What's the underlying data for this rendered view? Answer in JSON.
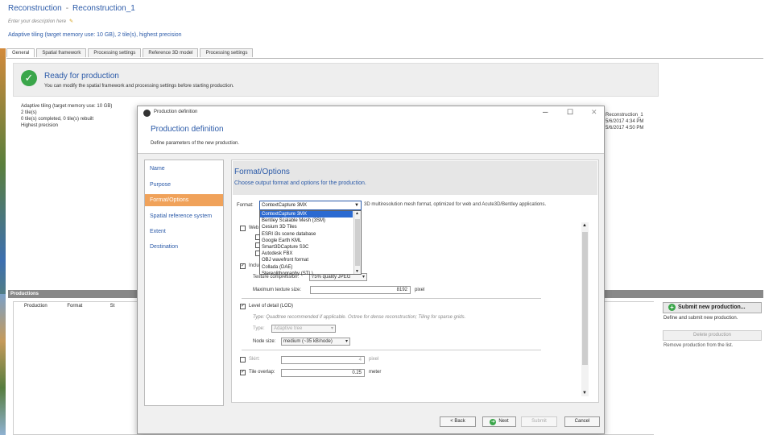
{
  "header": {
    "app_title": "Reconstruction",
    "doc_title": "Reconstruction_1",
    "subtitle": "Enter your description here",
    "info_line": "Adaptive tiling (target memory use: 10 GB), 2 tile(s), highest precision"
  },
  "tabs": [
    "General",
    "Spatial framework",
    "Processing settings",
    "Reference 3D model",
    "Processing settings"
  ],
  "banner": {
    "title": "Ready for production",
    "text": "You can modify the spatial framework and processing settings before starting production."
  },
  "background_details": {
    "left_lines": [
      "Adaptive tiling (target memory use: 10 GB)",
      "2 tile(s)",
      "0 tile(s) completed, 0 tile(s) rebuilt",
      "Highest precision"
    ],
    "right_lines": [
      "Reconstruction_1",
      "5/6/2017 4:34 PM",
      "5/6/2017 4:50 PM"
    ]
  },
  "productions": {
    "header": "Productions",
    "columns": [
      "Production",
      "Format",
      "St"
    ],
    "submit_label": "Submit new production...",
    "submit_desc": "Define and submit new production.",
    "delete_label": "Delete production",
    "delete_desc": "Remove production from the list."
  },
  "dialog": {
    "window_title": "Production definition",
    "heading": "Production definition",
    "subheading": "Define parameters of the new production.",
    "steps": [
      "Name",
      "Purpose",
      "Format/Options",
      "Spatial reference system",
      "Extent",
      "Destination"
    ],
    "active_step": 2,
    "content_title": "Format/Options",
    "content_sub": "Choose output format and options for the production.",
    "format_label": "Format:",
    "format_value": "ContextCapture 3MX",
    "format_desc": "3D multiresolution mesh format, optimized for web and Acute3D/Bentley applications.",
    "dropdown_options": [
      "ContextCapture 3MX",
      "Bentley Scalable Mesh (3SM)",
      "Cesium 3D Tiles",
      "ESRI i3s scene database",
      "Google Earth KML",
      "Smart3DCapture S3C",
      "Autodesk FBX",
      "OBJ wavefront format",
      "Collada (DAE)",
      "Stereolithography (STL)"
    ],
    "web_ready_label": "Web ready",
    "include_texture_label": "Include texture maps",
    "texture_compression_label": "Texture compression:",
    "texture_compression_value": "75% quality JPEG",
    "max_texture_label": "Maximum texture size:",
    "max_texture_value": "8192",
    "max_texture_unit": "pixel",
    "lod_label": "Level of detail (LOD)",
    "lod_hint": "Type: Quadtree recommended if applicable. Octree for dense reconstruction; Tiling for sparse grids.",
    "type_label": "Type:",
    "type_value": "Adaptive tree",
    "node_size_label": "Node size:",
    "node_size_value": "medium (~35 kB/node)",
    "skirt_label": "Skirt:",
    "skirt_value": "4",
    "skirt_unit": "pixel",
    "tile_overlap_label": "Tile overlap:",
    "tile_overlap_value": "0.25",
    "tile_overlap_unit": "meter",
    "buttons": {
      "back": "< Back",
      "next": "Next",
      "submit": "Submit",
      "cancel": "Cancel"
    }
  },
  "colors": {
    "accent": "#2b5aa8",
    "active_step": "#f0a25a",
    "ok": "#3aa64a",
    "selection": "#2b6ad1"
  }
}
